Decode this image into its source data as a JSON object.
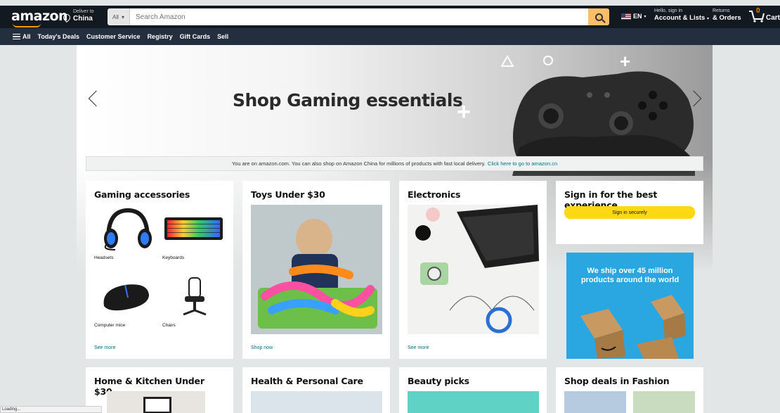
{
  "header": {
    "logo": "amazon",
    "deliver_to": "Deliver to",
    "deliver_country": "China",
    "search_category": "All",
    "search_placeholder": "Search Amazon",
    "language": "EN",
    "account_line1": "Hello, sign in",
    "account_line2": "Account & Lists",
    "returns_line1": "Returns",
    "returns_line2": "& Orders",
    "cart_count": "0",
    "cart_label": "Cart"
  },
  "subnav": {
    "all": "All",
    "items": [
      "Today's Deals",
      "Customer Service",
      "Registry",
      "Gift Cards",
      "Sell"
    ]
  },
  "hero": {
    "title": "Shop Gaming essentials"
  },
  "notice": {
    "text": "You are on amazon.com. You can also shop on Amazon China for millions of products with fast local delivery.",
    "link": "Click here to go to amazon.cn"
  },
  "cards": {
    "gaming": {
      "title": "Gaming accessories",
      "items": [
        "Headsets",
        "Keyboards",
        "Computer mice",
        "Chairs"
      ],
      "link": "See more"
    },
    "toys": {
      "title": "Toys Under $30",
      "link": "Shop now"
    },
    "electronics": {
      "title": "Electronics",
      "link": "See more"
    },
    "signin": {
      "title": "Sign in for the best experience",
      "button": "Sign in securely"
    },
    "ship": {
      "text": "We ship over 45 million products around the world"
    },
    "home": {
      "title": "Home & Kitchen Under $30"
    },
    "health": {
      "title": "Health & Personal Care"
    },
    "beauty": {
      "title": "Beauty picks"
    },
    "fashion": {
      "title": "Shop deals in Fashion"
    }
  },
  "statusbar": {
    "text": "Loading..."
  },
  "colors": {
    "header": "#131921",
    "subnav": "#232f3e",
    "search_button": "#febd69",
    "signin_button": "#ffd814",
    "link": "#007185",
    "ship_bg": "#2aa6e0"
  }
}
